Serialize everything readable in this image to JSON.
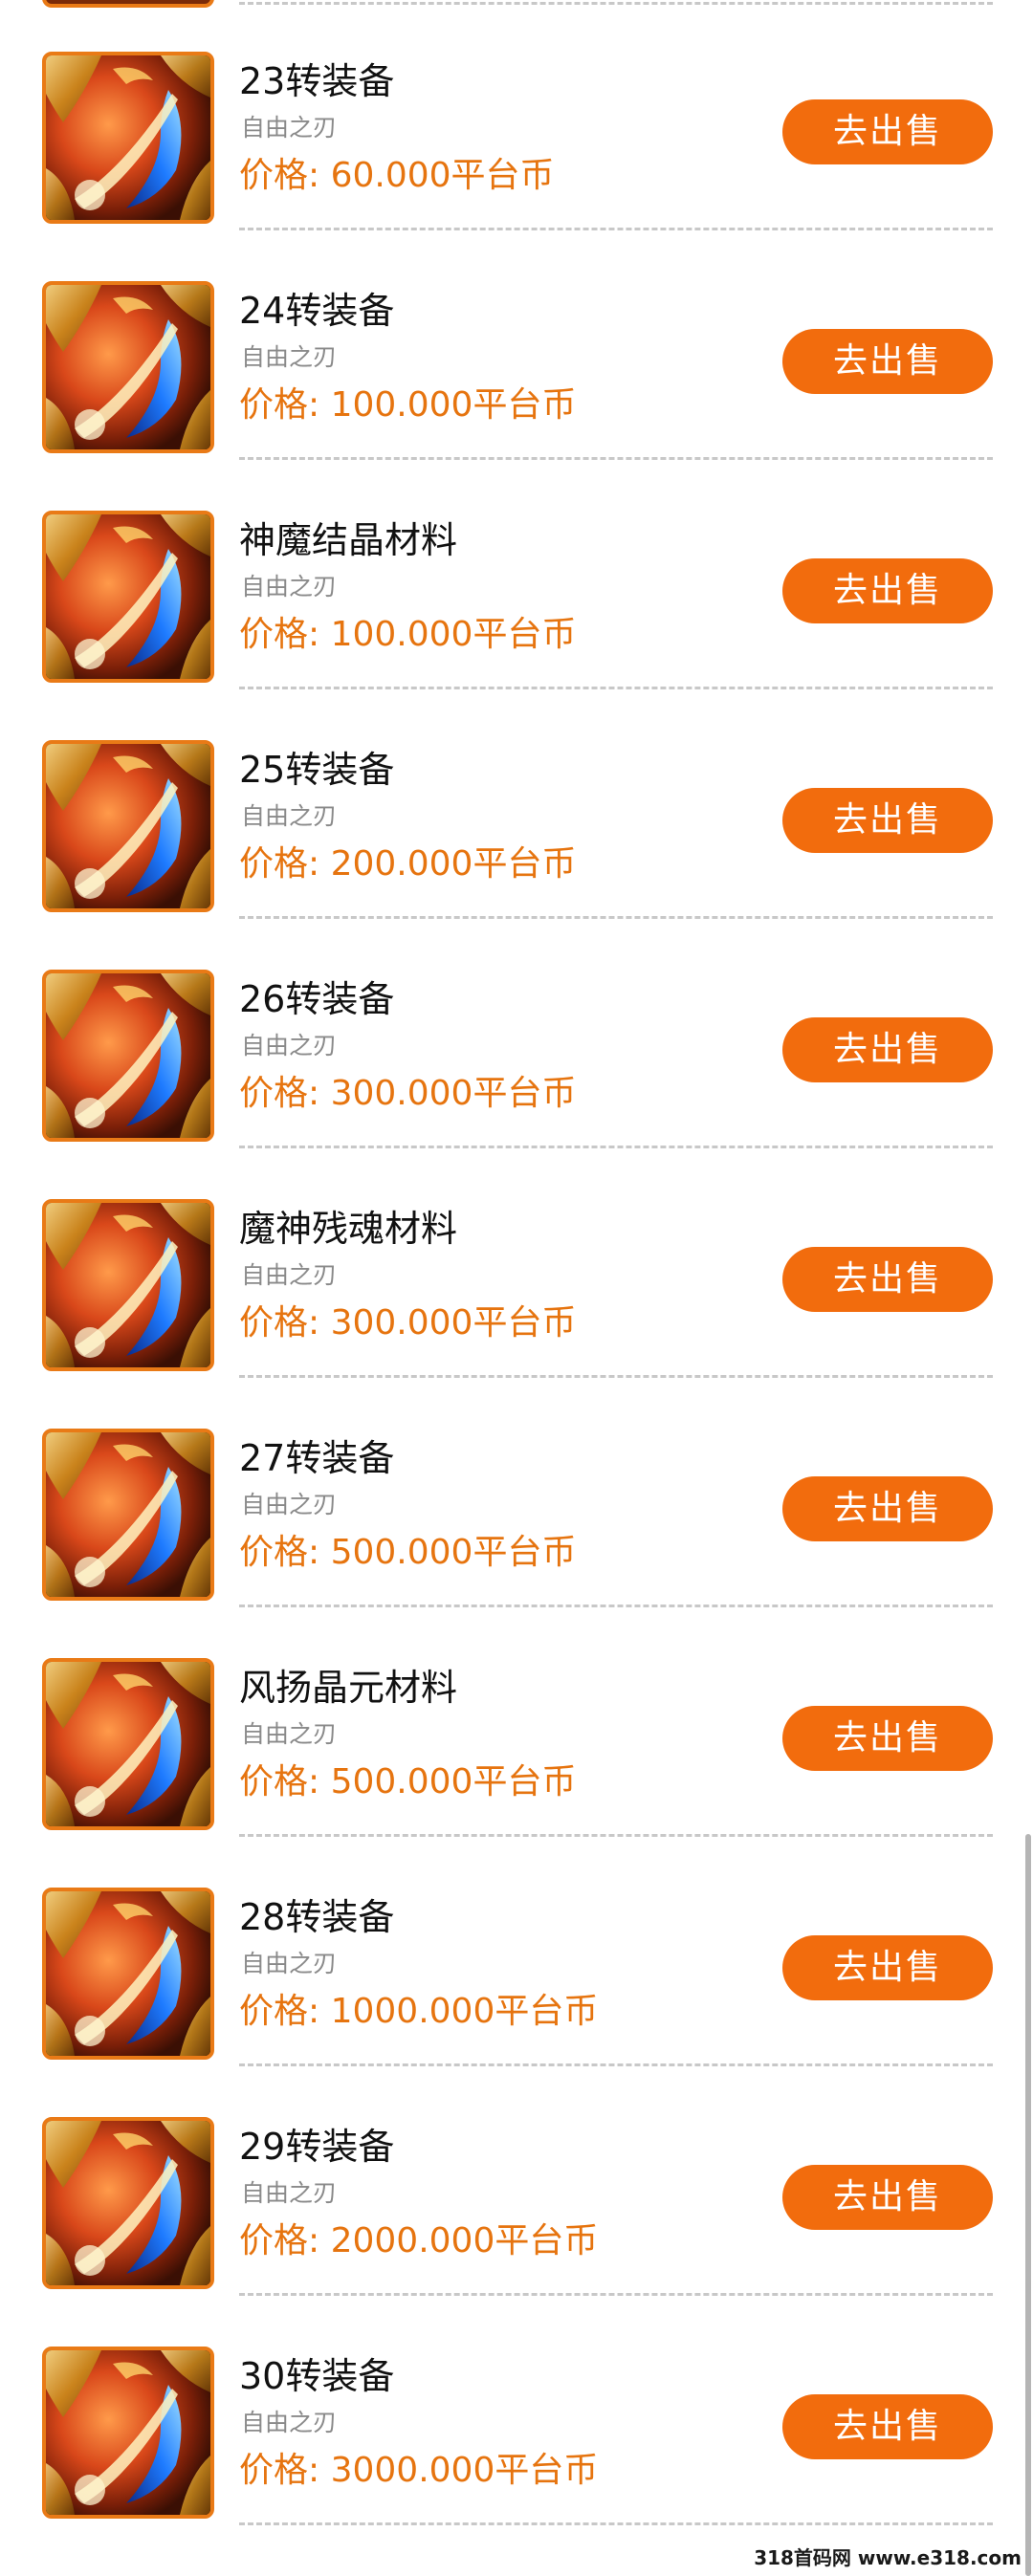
{
  "colors": {
    "accent": "#f26c0d",
    "price": "#e6740f",
    "divider": "#c8c8c8"
  },
  "item_icon": "game-sword-art-icon",
  "items": [
    {
      "name": "23转装备",
      "subtitle": "自由之刃",
      "price": "价格: 60.000平台币",
      "button": "去出售"
    },
    {
      "name": "24转装备",
      "subtitle": "自由之刃",
      "price": "价格: 100.000平台币",
      "button": "去出售"
    },
    {
      "name": "神魔结晶材料",
      "subtitle": "自由之刃",
      "price": "价格: 100.000平台币",
      "button": "去出售"
    },
    {
      "name": "25转装备",
      "subtitle": "自由之刃",
      "price": "价格: 200.000平台币",
      "button": "去出售"
    },
    {
      "name": "26转装备",
      "subtitle": "自由之刃",
      "price": "价格: 300.000平台币",
      "button": "去出售"
    },
    {
      "name": "魔神残魂材料",
      "subtitle": "自由之刃",
      "price": "价格: 300.000平台币",
      "button": "去出售"
    },
    {
      "name": "27转装备",
      "subtitle": "自由之刃",
      "price": "价格: 500.000平台币",
      "button": "去出售"
    },
    {
      "name": "风扬晶元材料",
      "subtitle": "自由之刃",
      "price": "价格: 500.000平台币",
      "button": "去出售"
    },
    {
      "name": "28转装备",
      "subtitle": "自由之刃",
      "price": "价格: 1000.000平台币",
      "button": "去出售"
    },
    {
      "name": "29转装备",
      "subtitle": "自由之刃",
      "price": "价格: 2000.000平台币",
      "button": "去出售"
    },
    {
      "name": "30转装备",
      "subtitle": "自由之刃",
      "price": "价格: 3000.000平台币",
      "button": "去出售"
    }
  ],
  "watermark": "318首码网 www.e318.com"
}
